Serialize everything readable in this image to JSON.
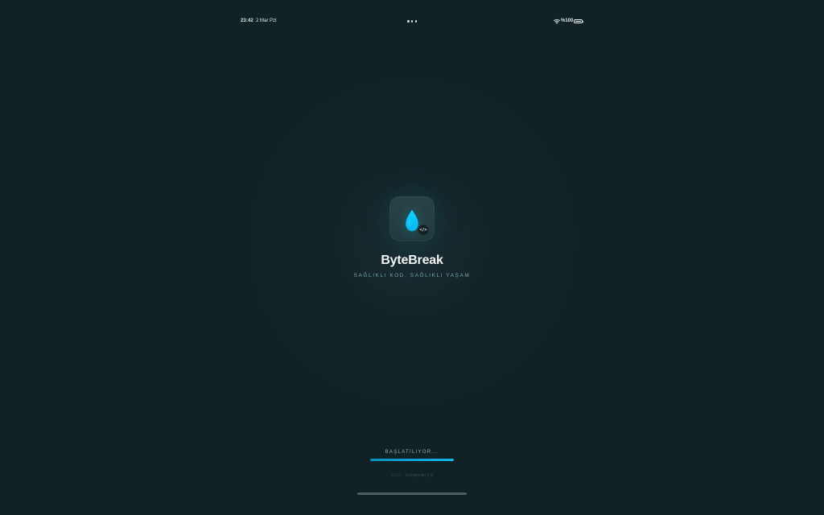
{
  "status_bar": {
    "time": "23:42",
    "date": "2 Mar Pzt",
    "battery": "%100",
    "battery_level": 1
  },
  "splash": {
    "title": "ByteBreak",
    "subtitle": "SAĞLIKLI KOD, SAĞLIKLI YAŞAM",
    "loading_label": "BAŞLATILIYOR...",
    "loading_progress": 1,
    "version_note": "v1.0.2 · Geliştiriciler İçin",
    "badge_symbol": "</>"
  },
  "icons": {
    "app": "water-drop-icon",
    "badge": "code-icon",
    "status": [
      "wifi-icon",
      "battery-icon"
    ]
  },
  "colors": {
    "background": "#112226",
    "accent": "#13b6e9",
    "subtitle": "#78a4ac"
  }
}
